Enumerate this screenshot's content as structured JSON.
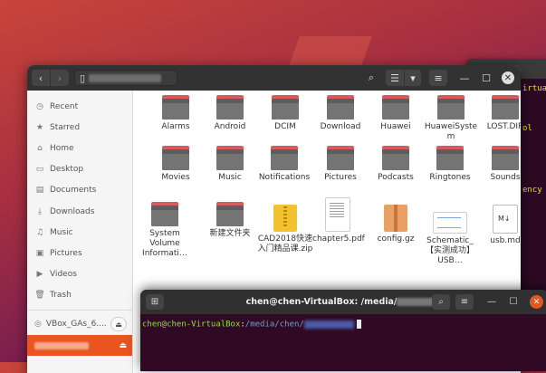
{
  "wallpaper": {
    "accent": "#c8453a"
  },
  "bg_terminal": {
    "lines": [
      "irtua",
      "ol",
      "ency"
    ]
  },
  "file_manager": {
    "header": {
      "back_icon": "‹",
      "forward_icon": "›",
      "path_icon": "▯",
      "search_icon": "⌕",
      "view_icon": "☰",
      "view_options_icon": "▾",
      "menu_icon": "≡",
      "minimize_icon": "—",
      "maximize_icon": "☐",
      "close_icon": "✕"
    },
    "sidebar": {
      "items": [
        {
          "icon": "◷",
          "label": "Recent"
        },
        {
          "icon": "★",
          "label": "Starred"
        },
        {
          "icon": "⌂",
          "label": "Home"
        },
        {
          "icon": "▭",
          "label": "Desktop"
        },
        {
          "icon": "▤",
          "label": "Documents"
        },
        {
          "icon": "⤓",
          "label": "Downloads"
        },
        {
          "icon": "♫",
          "label": "Music"
        },
        {
          "icon": "▣",
          "label": "Pictures"
        },
        {
          "icon": "▶",
          "label": "Videos"
        },
        {
          "icon": "🗑",
          "label": "Trash"
        }
      ],
      "devices": [
        {
          "icon": "◎",
          "label": "VBox_GAs_6....",
          "eject": "⏏"
        }
      ],
      "active_device": {
        "eject": "⏏"
      }
    },
    "items": [
      {
        "name": "Alarms",
        "type": "folder"
      },
      {
        "name": "Android",
        "type": "folder"
      },
      {
        "name": "DCIM",
        "type": "folder"
      },
      {
        "name": "Download",
        "type": "folder"
      },
      {
        "name": "Huawei",
        "type": "folder"
      },
      {
        "name": "HuaweiSystem",
        "type": "folder"
      },
      {
        "name": "LOST.DIR",
        "type": "folder"
      },
      {
        "name": "Movies",
        "type": "folder"
      },
      {
        "name": "Music",
        "type": "folder"
      },
      {
        "name": "Notifications",
        "type": "folder"
      },
      {
        "name": "Pictures",
        "type": "folder"
      },
      {
        "name": "Podcasts",
        "type": "folder"
      },
      {
        "name": "Ringtones",
        "type": "folder"
      },
      {
        "name": "Sounds",
        "type": "folder"
      },
      {
        "name": "System Volume Informati…",
        "type": "folder"
      },
      {
        "name": "新建文件夹",
        "type": "folder"
      },
      {
        "name": "CAD2018快速入门精品课.zip",
        "type": "zip"
      },
      {
        "name": "chapter5.pdf",
        "type": "pdf"
      },
      {
        "name": "config.gz",
        "type": "gz"
      },
      {
        "name": "Schematic_【实测成功】USB…",
        "type": "img"
      },
      {
        "name": "usb.md",
        "type": "md"
      }
    ]
  },
  "terminal": {
    "title": "chen@chen-VirtualBox: /media/",
    "prompt_user": "chen@chen-VirtualBox",
    "prompt_sep": ":",
    "prompt_path": "/media/chen/",
    "new_tab_icon": "⊞",
    "search_icon": "⌕",
    "menu_icon": "≡",
    "minimize_icon": "—",
    "maximize_icon": "☐",
    "close_icon": "✕"
  }
}
